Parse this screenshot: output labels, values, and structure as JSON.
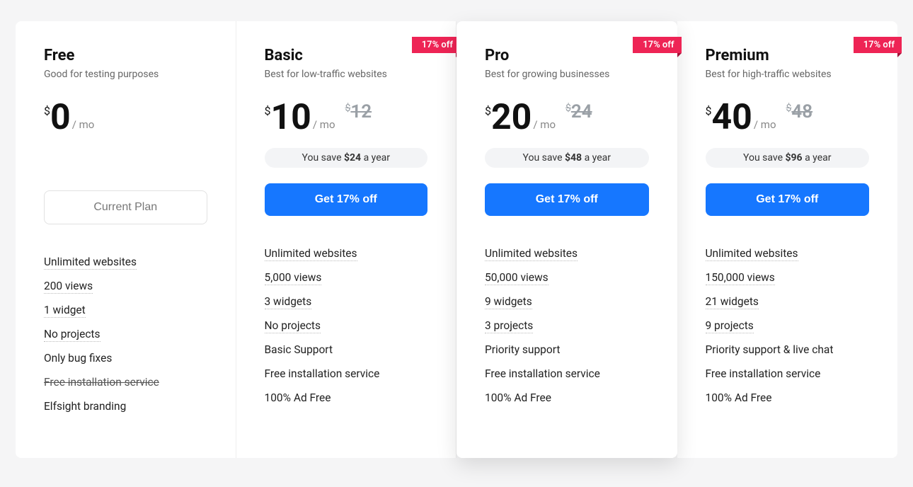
{
  "currency": "$",
  "per_label": "/ mo",
  "discount_ribbon": "17% off",
  "save_prefix": "You save ",
  "save_suffix": " a year",
  "plans": [
    {
      "name": "Free",
      "desc": "Good for testing purposes",
      "price": "0",
      "old_price": null,
      "save_amount": null,
      "cta": "Current Plan",
      "cta_kind": "current",
      "ribbon": false,
      "featured": false,
      "features": [
        {
          "text": "Unlimited websites",
          "dotted": true,
          "strike": false
        },
        {
          "text": "200 views",
          "dotted": true,
          "strike": false
        },
        {
          "text": "1 widget",
          "dotted": true,
          "strike": false
        },
        {
          "text": "No projects",
          "dotted": true,
          "strike": false
        },
        {
          "text": "Only bug fixes",
          "dotted": false,
          "strike": false
        },
        {
          "text": "Free installation service",
          "dotted": false,
          "strike": true
        },
        {
          "text": "Elfsight branding",
          "dotted": false,
          "strike": false
        }
      ]
    },
    {
      "name": "Basic",
      "desc": "Best for low-traffic websites",
      "price": "10",
      "old_price": "12",
      "save_amount": "$24",
      "cta": "Get 17% off",
      "cta_kind": "primary",
      "ribbon": true,
      "featured": false,
      "features": [
        {
          "text": "Unlimited websites",
          "dotted": true,
          "strike": false
        },
        {
          "text": "5,000 views",
          "dotted": true,
          "strike": false
        },
        {
          "text": "3 widgets",
          "dotted": true,
          "strike": false
        },
        {
          "text": "No projects",
          "dotted": true,
          "strike": false
        },
        {
          "text": "Basic Support",
          "dotted": false,
          "strike": false
        },
        {
          "text": "Free installation service",
          "dotted": false,
          "strike": false
        },
        {
          "text": "100% Ad Free",
          "dotted": false,
          "strike": false
        }
      ]
    },
    {
      "name": "Pro",
      "desc": "Best for growing businesses",
      "price": "20",
      "old_price": "24",
      "save_amount": "$48",
      "cta": "Get 17% off",
      "cta_kind": "primary",
      "ribbon": true,
      "featured": true,
      "features": [
        {
          "text": "Unlimited websites",
          "dotted": true,
          "strike": false
        },
        {
          "text": "50,000 views",
          "dotted": true,
          "strike": false
        },
        {
          "text": "9 widgets",
          "dotted": true,
          "strike": false
        },
        {
          "text": "3 projects",
          "dotted": true,
          "strike": false
        },
        {
          "text": "Priority support",
          "dotted": false,
          "strike": false
        },
        {
          "text": "Free installation service",
          "dotted": false,
          "strike": false
        },
        {
          "text": "100% Ad Free",
          "dotted": false,
          "strike": false
        }
      ]
    },
    {
      "name": "Premium",
      "desc": "Best for high-traffic websites",
      "price": "40",
      "old_price": "48",
      "save_amount": "$96",
      "cta": "Get 17% off",
      "cta_kind": "primary",
      "ribbon": true,
      "featured": false,
      "features": [
        {
          "text": "Unlimited websites",
          "dotted": true,
          "strike": false
        },
        {
          "text": "150,000 views",
          "dotted": true,
          "strike": false
        },
        {
          "text": "21 widgets",
          "dotted": true,
          "strike": false
        },
        {
          "text": "9 projects",
          "dotted": true,
          "strike": false
        },
        {
          "text": "Priority support & live chat",
          "dotted": false,
          "strike": false
        },
        {
          "text": "Free installation service",
          "dotted": false,
          "strike": false
        },
        {
          "text": "100% Ad Free",
          "dotted": false,
          "strike": false
        }
      ]
    }
  ]
}
